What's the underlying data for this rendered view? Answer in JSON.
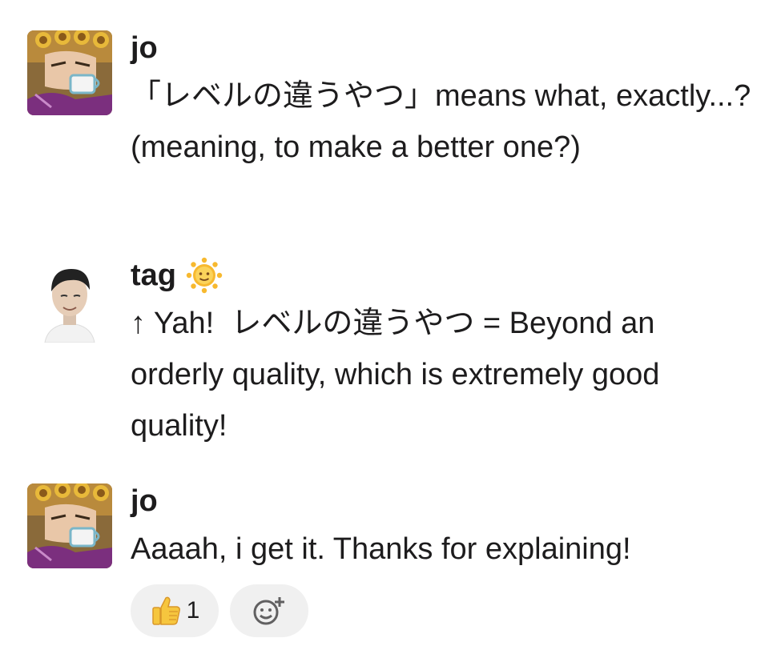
{
  "messages": [
    {
      "username": "jo",
      "avatar": "jojo-avatar-icon",
      "text": "「レベルの違うやつ」means what, exactly...? (meaning, to make a better one?)"
    },
    {
      "username": "tag",
      "avatar": "person-avatar-icon",
      "status_emoji": "sun-face-icon",
      "text": "↑ Yah!  レベルの違うやつ = Beyond an orderly quality, which is extremely good quality!"
    },
    {
      "username": "jo",
      "avatar": "jojo-avatar-icon",
      "text": "Aaaah, i get it. Thanks for explaining!",
      "reactions": [
        {
          "emoji": "thumbs-up-icon",
          "count": "1"
        }
      ],
      "add_reaction_icon": "add-reaction-icon"
    }
  ],
  "colors": {
    "text": "#1d1c1d",
    "pill_bg": "#f0f0f0",
    "avatar_purple": "#7b2f7e",
    "avatar_gold": "#e0a92c",
    "sun": "#f7b92f"
  }
}
